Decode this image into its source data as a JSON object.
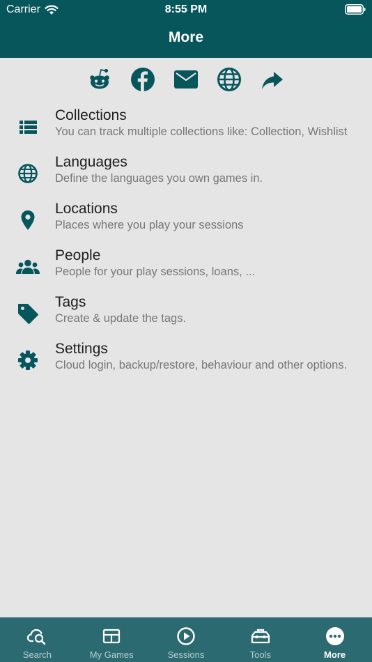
{
  "status_bar": {
    "carrier": "Carrier",
    "time": "8:55 PM"
  },
  "header": {
    "title": "More"
  },
  "share_icons": [
    "reddit-icon",
    "facebook-icon",
    "email-icon",
    "globe-icon",
    "share-icon"
  ],
  "menu": {
    "items": [
      {
        "title": "Collections",
        "subtitle": "You can track multiple collections like: Collection, Wishlist",
        "icon": "list-icon"
      },
      {
        "title": "Languages",
        "subtitle": "Define the languages you own games in.",
        "icon": "globe-icon"
      },
      {
        "title": "Locations",
        "subtitle": "Places where you play your sessions",
        "icon": "location-pin-icon"
      },
      {
        "title": "People",
        "subtitle": "People for your play sessions, loans, ...",
        "icon": "people-icon"
      },
      {
        "title": "Tags",
        "subtitle": "Create & update the tags.",
        "icon": "tag-icon"
      },
      {
        "title": "Settings",
        "subtitle": "Cloud login, backup/restore, behaviour and other options.",
        "icon": "gear-icon"
      }
    ]
  },
  "tabbar": {
    "active": "More",
    "tabs": [
      {
        "label": "Search",
        "icon": "cloud-search-icon"
      },
      {
        "label": "My Games",
        "icon": "games-board-icon"
      },
      {
        "label": "Sessions",
        "icon": "play-circle-icon"
      },
      {
        "label": "Tools",
        "icon": "toolbox-icon"
      },
      {
        "label": "More",
        "icon": "more-dots-icon"
      }
    ]
  },
  "colors": {
    "primary": "#07565c",
    "tabbar": "#2b6a70",
    "background": "#e5e5e5"
  }
}
